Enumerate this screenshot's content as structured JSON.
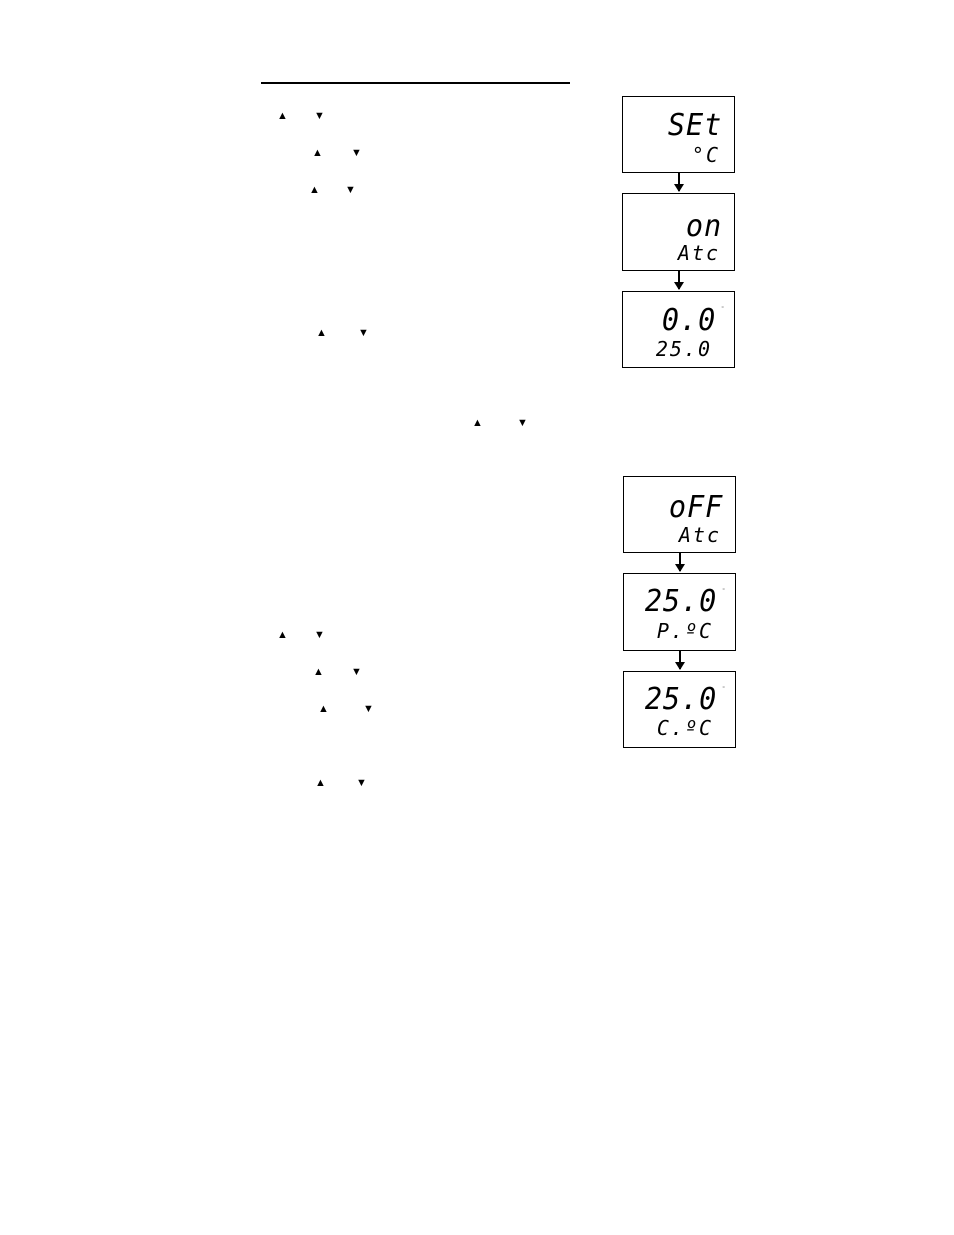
{
  "icons": {
    "up": "▲",
    "down": "▼"
  },
  "section1": {
    "displays": [
      {
        "main": "SEt",
        "sub": "°C",
        "deg": ""
      },
      {
        "main": "on",
        "sub": "Atc",
        "deg": ""
      },
      {
        "main": "0.0",
        "sub": "25.0",
        "deg": "°"
      }
    ]
  },
  "section2": {
    "displays": [
      {
        "main": "oFF",
        "sub": "Atc",
        "deg": ""
      },
      {
        "main": "25.0",
        "sub": "P.ºC",
        "deg": "°"
      },
      {
        "main": "25.0",
        "sub": "C.ºC",
        "deg": "°"
      }
    ]
  }
}
